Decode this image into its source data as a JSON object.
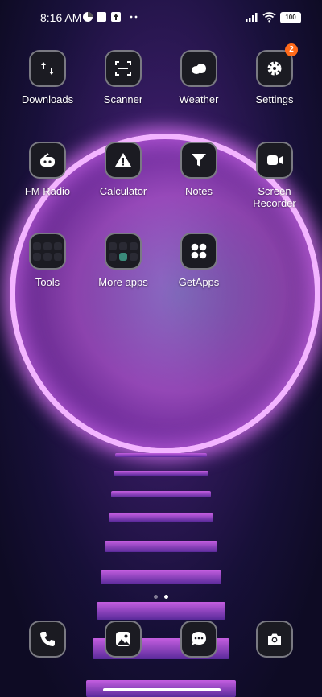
{
  "status_bar": {
    "time": "8:16 AM",
    "battery": "100"
  },
  "apps_row1": [
    {
      "label": "Downloads",
      "icon": "download-icon"
    },
    {
      "label": "Scanner",
      "icon": "scanner-icon"
    },
    {
      "label": "Weather",
      "icon": "cloud-icon"
    },
    {
      "label": "Settings",
      "icon": "gear-icon",
      "badge": "2"
    }
  ],
  "apps_row2": [
    {
      "label": "FM Radio",
      "icon": "radio-icon"
    },
    {
      "label": "Calculator",
      "icon": "warning-icon"
    },
    {
      "label": "Notes",
      "icon": "funnel-icon"
    },
    {
      "label": "Screen Recorder",
      "icon": "video-camera-icon"
    }
  ],
  "apps_row3": [
    {
      "label": "Tools",
      "icon": "folder-icon"
    },
    {
      "label": "More apps",
      "icon": "folder-icon"
    },
    {
      "label": "GetApps",
      "icon": "grid-icon"
    }
  ],
  "dock": [
    {
      "icon": "phone-icon"
    },
    {
      "icon": "gallery-icon"
    },
    {
      "icon": "message-icon"
    },
    {
      "icon": "camera-icon"
    }
  ],
  "page_indicator": {
    "total": 2,
    "current": 2
  },
  "colors": {
    "badge": "#ff6a1a",
    "ring": "#f3b4ff",
    "icon_bg": "#1b1b22"
  }
}
